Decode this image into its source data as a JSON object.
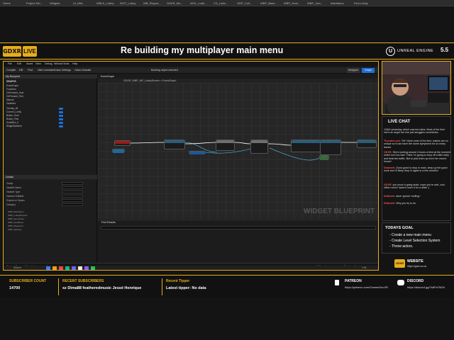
{
  "top_bar": {
    "tabs": [
      "Home",
      "Project Set...",
      "Widgets",
      "UI_Wid...",
      "WBLK_Lobby",
      "WGT_Lobby",
      "WB_PlayerL...",
      "GDKR_Mo...",
      "WGL_Lobb...",
      "CS_Lobb...",
      "GRP_Coll...",
      "WBP_Base...",
      "WBP_Host...",
      "WBP_Join...",
      "MainMenu",
      "Find Lobby"
    ]
  },
  "banner": {
    "logo": "GDXR",
    "live": "LIVE",
    "title": "Re building my multiplayer main menu",
    "engine": "UNREAL ENGINE",
    "engine_logo": "U",
    "version": "5.5"
  },
  "editor": {
    "menus": [
      "File",
      "Edit",
      "Asset",
      "View",
      "Debug",
      "Window",
      "Tools",
      "Help"
    ],
    "toolbar": [
      "Compile",
      "Diff",
      "Find",
      "Hide Unrelated",
      "Class Settings",
      "Class Defaults",
      "Building object selected"
    ],
    "designer_label": "Designer",
    "graph_label": "Graph",
    "my_blueprint_label": "My Blueprint",
    "graphs_label": "GRAPHS",
    "tree": [
      "EventGraph",
      "Functions",
      "OnPressed_Host",
      "OnPressed_Find",
      "Macros",
      "Variables"
    ],
    "variables": [
      {
        "name": "Overlay_48",
        "color": "#1e6fd9"
      },
      {
        "name": "Current_Lobby",
        "color": "#1e6fd9"
      },
      {
        "name": "Button_Host",
        "color": "#1e6fd9"
      },
      {
        "name": "Button_Find",
        "color": "#1e6fd9"
      },
      {
        "name": "ScrollBox_0",
        "color": "#1e6fd9"
      },
      {
        "name": "WidgetSwitcher",
        "color": "#1e6fd9"
      }
    ],
    "details_label": "Details",
    "details_rows": [
      "Tooltip",
      "Variable Name",
      "Variable Type",
      "Instance Editable",
      "Expose on Spawn",
      "Category"
    ],
    "details_list": [
      "WBP_MainMenu",
      "WBP_LobbyBrowser",
      "WBP_ServerRow",
      "WBP_HostMenu",
      "WBP_PlayerList",
      "WBP_Settings"
    ],
    "graph_tab": "EventGraph",
    "breadcrumb": "GDXR_WBP_MP_LobbyScreen > EventGraph",
    "watermark": "WIDGET BLUEPRINT",
    "find_label": "Find Results",
    "status": [
      "Content Drawer",
      "Output Log",
      "Cmd",
      "All Saved",
      "Revision Control"
    ],
    "tasks": {
      "search": "Search",
      "time": "1:51"
    }
  },
  "chat": {
    "title": "LIVE CHAT",
    "messages": [
      {
        "user": "",
        "text": "12AM yesterday which was fun haha. Most of the time she's an angel but she just struggles sometimes."
      },
      {
        "user": "ThunderLuck:",
        "text": "Tbf I think most of the time, babies are so unique so it can have the same symptoms for so many issues"
      },
      {
        "user": "GDXR:",
        "text": "She's looking around 4 hours a feed at the moment which isn't too bad. Think I'm going to drop off a little early and beat the traffic. But to pick them up from her mum's house!"
      },
      {
        "user": "Drakewh:",
        "text": "Good good to drop in main, keep up the good work and I'll likely drop in again in a few months!"
      },
      {
        "user": "GDXR:",
        "text": "you know it going dude, hope you're well, cool office room!! haven't seen it for a while :)"
      },
      {
        "user": "Drakewh:",
        "text": "dace~goose~smiling~"
      },
      {
        "user": "Drakewh:",
        "text": "Why you try to do"
      }
    ]
  },
  "goals": {
    "title": "TODAYS GOAL",
    "items": [
      "- Create a new main menu",
      "- Create Level Selection System",
      "- Throw actors."
    ]
  },
  "website": {
    "badge": "GDXR",
    "label": "WEBSITE",
    "url": "https://gdxr.co.uk"
  },
  "bottom": {
    "subscriber_label": "SUBSCRIBER COUNT",
    "subscriber_count": "14700",
    "recent_label": "RECENT SUBSCRIBERS",
    "recent_list": "sz    Dima88    featheredmusic    Jessé Henrique",
    "tipper_label": "Recent Tipper",
    "tipper_value": "Latest tipper: No data",
    "patreon_label": "PATREON",
    "patreon_url": "https://patreon.com/GamesDevXR",
    "discord_label": "DISCORD",
    "discord_url": "https://discord.gg/7s6Pn7M2h"
  }
}
